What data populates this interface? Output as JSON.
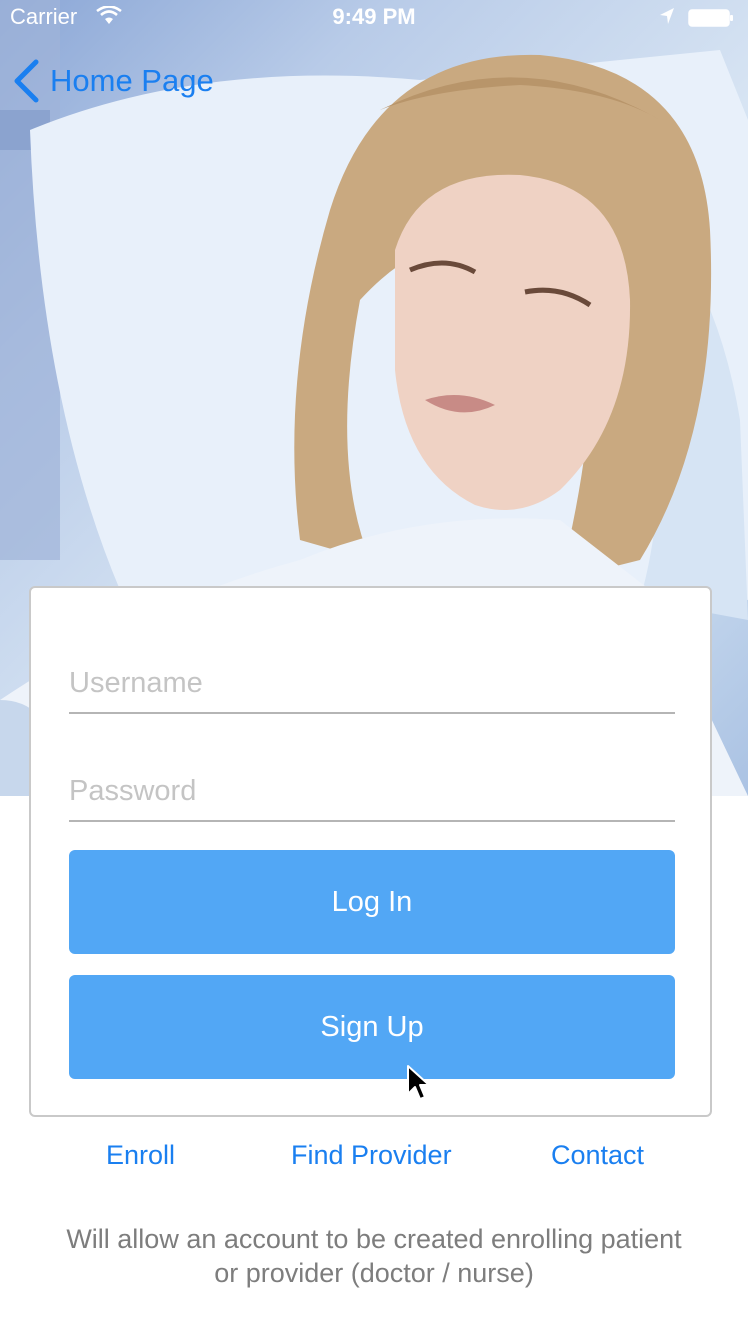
{
  "status_bar": {
    "carrier": "Carrier",
    "time": "9:49 PM",
    "icons": [
      "wifi-icon",
      "location-icon",
      "battery-icon"
    ]
  },
  "nav": {
    "back_label": "Home Page",
    "back_icon": "chevron-left-icon"
  },
  "login_form": {
    "username_placeholder": "Username",
    "password_placeholder": "Password",
    "login_label": "Log In",
    "signup_label": "Sign Up"
  },
  "links": {
    "enroll": "Enroll",
    "find_provider": "Find Provider",
    "contact": "Contact"
  },
  "description": "Will allow an account to be created enrolling patient or provider (doctor / nurse)",
  "colors": {
    "accent": "#1a7ff0",
    "button": "#52a7f5",
    "muted_text": "#7d7d7d",
    "placeholder": "#c4c4c4"
  }
}
